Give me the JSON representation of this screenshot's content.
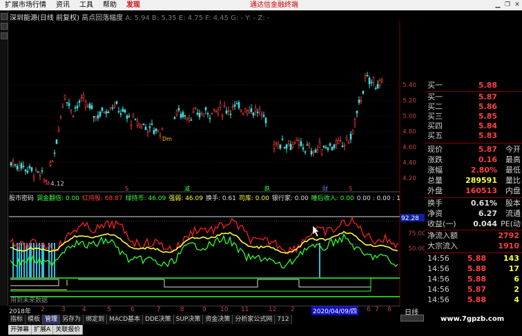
{
  "menu": {
    "items": [
      "扩展市场行情",
      "资讯",
      "工具",
      "帮助",
      "发现"
    ],
    "promo": "通达信金融终端"
  },
  "title": {
    "stock": "深圳能源(日线 前复权)",
    "indicator": "高点回落幅度",
    "readout": "A: 5.94  B: 5.35  E: 4.75  F: 4.45  G: -  Y: -  Z: -"
  },
  "price_axis": [
    "5.40",
    "5.20",
    "5.00",
    "4.80",
    "4.60",
    "4.40",
    "4.20"
  ],
  "chart_labels": {
    "low": "4.12",
    "marker": "Dm"
  },
  "event_markers": [
    "S",
    "减",
    "跌",
    "财",
    "S"
  ],
  "indicator_bar": [
    {
      "label": "股市密码",
      "color": "white"
    },
    {
      "label": "调金翻倍: 0.00",
      "color": "green"
    },
    {
      "label": "红持股: 68.87",
      "color": "red"
    },
    {
      "label": "绿持币: 46.09",
      "color": "green"
    },
    {
      "label": "强弱: 46.09",
      "color": "yellow"
    },
    {
      "label": "换手: 0.61",
      "color": "white"
    },
    {
      "label": "司库: 0.00",
      "color": "yellow"
    },
    {
      "label": "银行家: 0.00",
      "color": "white"
    },
    {
      "label": "睡后收入: 0.00",
      "color": "green"
    },
    {
      "label": "0.00 : 0.00 : 10",
      "color": "white"
    }
  ],
  "osc_axis": {
    "top_value": "92.28",
    "mid": "75.00",
    "low": "50.00"
  },
  "sub_hint": "用到未来数据",
  "quote_panel": {
    "asks": [
      {
        "label": "买一",
        "price": "5.88"
      }
    ],
    "bids": [
      {
        "label": "买一",
        "price": "5.87"
      },
      {
        "label": "买二",
        "price": "5.86"
      },
      {
        "label": "买三",
        "price": "5.85"
      },
      {
        "label": "买四",
        "price": "5.84"
      },
      {
        "label": "买五",
        "price": "5.83"
      }
    ],
    "stats": [
      {
        "label": "现价",
        "value": "5.87",
        "label2": "今开",
        "color": "red"
      },
      {
        "label": "涨跌",
        "value": "0.16",
        "label2": "最高",
        "color": "red"
      },
      {
        "label": "涨幅",
        "value": "2.80%",
        "label2": "最低",
        "color": "red"
      },
      {
        "label": "总量",
        "value": "289591",
        "label2": "量比",
        "color": "yellow"
      },
      {
        "label": "外盘",
        "value": "160513",
        "label2": "内盘",
        "color": "red"
      }
    ],
    "stats2": [
      {
        "label": "换手",
        "value": "0.61%",
        "label2": "股本",
        "color": "white"
      },
      {
        "label": "净资",
        "value": "6.27",
        "label2": "流通",
        "color": "white"
      },
      {
        "label": "收益(一)",
        "value": "0.044",
        "label2": "PE(动",
        "color": "white"
      }
    ],
    "flows": [
      {
        "label": "净流入额",
        "value": "2792"
      },
      {
        "label": "大宗流入",
        "value": "1910"
      }
    ],
    "ticks": [
      {
        "time": "14:56",
        "price": "5.88",
        "vol": "143",
        "pc": "red",
        "vc": "yellow"
      },
      {
        "time": "14:56",
        "price": "5.88",
        "vol": "17",
        "pc": "red",
        "vc": "yellow"
      },
      {
        "time": "14:56",
        "price": "5.88",
        "vol": "6",
        "pc": "red",
        "vc": "yellow"
      },
      {
        "time": "14:56",
        "price": "5.87",
        "vol": "2",
        "pc": "red",
        "vc": "yellow"
      },
      {
        "time": "14:56",
        "price": "5.88",
        "vol": "4",
        "pc": "red",
        "vc": "yellow"
      }
    ]
  },
  "datebar": {
    "year": "2018年",
    "months": [
      "2",
      "3",
      "4",
      "5",
      "6",
      "7",
      "8",
      "9",
      "10",
      "11",
      "12",
      "2",
      "3",
      "4",
      "5",
      "6",
      "7",
      "8"
    ],
    "selected": "2020/04/09/四"
  },
  "right_label": "日线",
  "tabs1": [
    "指标",
    "模板",
    "管理",
    "另存为",
    "绑定到",
    "MACD基本",
    "DDE决策",
    "SUP决策",
    "资金决策",
    "分析家公式网",
    "712"
  ],
  "tabs1_active": "管理",
  "tabs2": [
    "开弹幕",
    "扩展A",
    "关联报价"
  ],
  "watermark": "www.7gpzb.com"
}
